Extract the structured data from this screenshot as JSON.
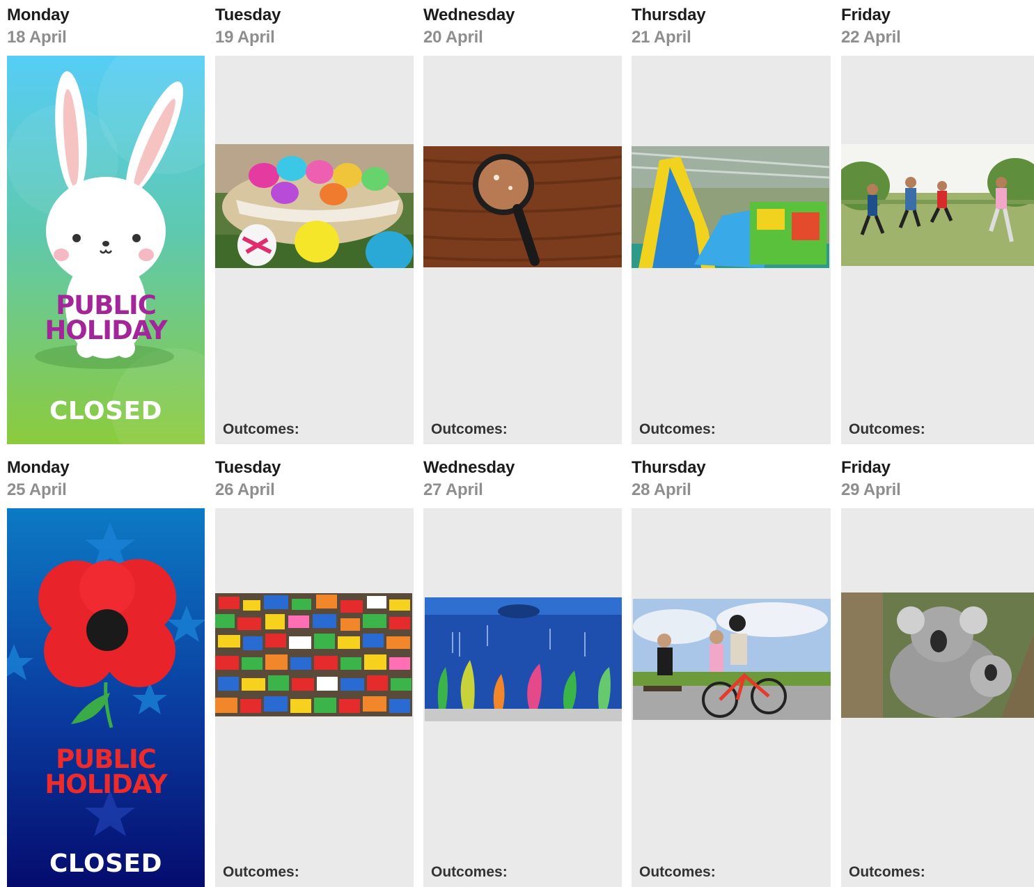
{
  "weeks": [
    {
      "days": [
        {
          "name": "Monday",
          "date": "18 April"
        },
        {
          "name": "Tuesday",
          "date": "19 April",
          "outcomes": "Outcomes:"
        },
        {
          "name": "Wednesday",
          "date": "20 April",
          "outcomes": "Outcomes:"
        },
        {
          "name": "Thursday",
          "date": "21 April",
          "outcomes": "Outcomes:"
        },
        {
          "name": "Friday",
          "date": "22 April",
          "outcomes": "Outcomes:"
        }
      ],
      "holiday": {
        "line1": "PUBLIC",
        "line2": "HOLIDAY",
        "closed": "CLOSED"
      }
    },
    {
      "days": [
        {
          "name": "Monday",
          "date": "25 April"
        },
        {
          "name": "Tuesday",
          "date": "26 April",
          "outcomes": "Outcomes:"
        },
        {
          "name": "Wednesday",
          "date": "27 April",
          "outcomes": "Outcomes:"
        },
        {
          "name": "Thursday",
          "date": "28 April",
          "outcomes": "Outcomes:"
        },
        {
          "name": "Friday",
          "date": "29 April",
          "outcomes": "Outcomes:"
        }
      ],
      "holiday": {
        "line1": "PUBLIC",
        "line2": "HOLIDAY",
        "closed": "CLOSED"
      }
    }
  ],
  "colors": {
    "card_bg": "#eaeaea",
    "easter_text": "#a3259a",
    "anzac_text": "#ee2b2b"
  }
}
